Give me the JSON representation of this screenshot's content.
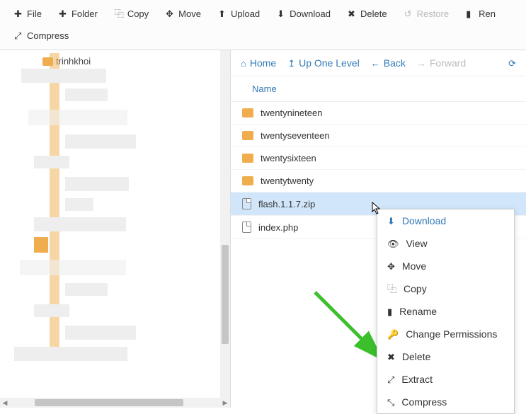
{
  "toolbar": {
    "file": "File",
    "folder": "Folder",
    "copy": "Copy",
    "move": "Move",
    "upload": "Upload",
    "download": "Download",
    "delete": "Delete",
    "restore": "Restore",
    "rename": "Ren",
    "compress": "Compress"
  },
  "sidebar": {
    "tree_item": "trinhkhoi"
  },
  "nav": {
    "home": "Home",
    "up": "Up One Level",
    "back": "Back",
    "forward": "Forward"
  },
  "columns": {
    "name": "Name"
  },
  "files": [
    {
      "name": "twentynineteen",
      "type": "folder"
    },
    {
      "name": "twentyseventeen",
      "type": "folder"
    },
    {
      "name": "twentysixteen",
      "type": "folder"
    },
    {
      "name": "twentytwenty",
      "type": "folder"
    },
    {
      "name": "flash.1.1.7.zip",
      "type": "zip",
      "selected": true
    },
    {
      "name": "index.php",
      "type": "php"
    }
  ],
  "context": {
    "download": "Download",
    "view": "View",
    "move": "Move",
    "copy": "Copy",
    "rename": "Rename",
    "permissions": "Change Permissions",
    "delete": "Delete",
    "extract": "Extract",
    "compress": "Compress"
  }
}
